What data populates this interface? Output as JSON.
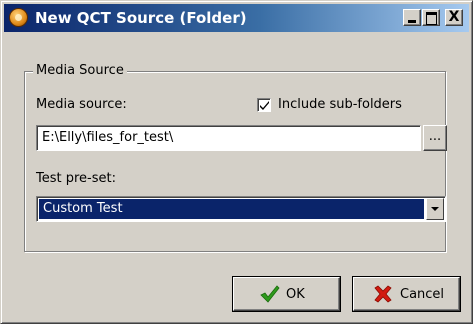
{
  "window": {
    "title": "New QCT Source (Folder)",
    "app_icon": "qct-app-icon",
    "close_glyph": "X"
  },
  "group": {
    "legend": "Media Source"
  },
  "media_source": {
    "label": "Media source:",
    "value": "E:\\Elly\\files_for_test\\",
    "browse_label": "...",
    "include_subfolders_label": "Include sub-folders",
    "include_subfolders_checked": true
  },
  "test_preset": {
    "label": "Test pre-set:",
    "selected": "Custom Test"
  },
  "buttons": {
    "ok_label": "OK",
    "ok_icon": "checkmark-icon",
    "cancel_label": "Cancel",
    "cancel_icon": "red-x-icon"
  },
  "colors": {
    "title_gradient_start": "#0a246a",
    "title_gradient_end": "#a6caf0",
    "face": "#d4d0c8",
    "selection": "#0a246a",
    "ok_check": "#2e9a1c",
    "cancel_x": "#d21a10"
  }
}
